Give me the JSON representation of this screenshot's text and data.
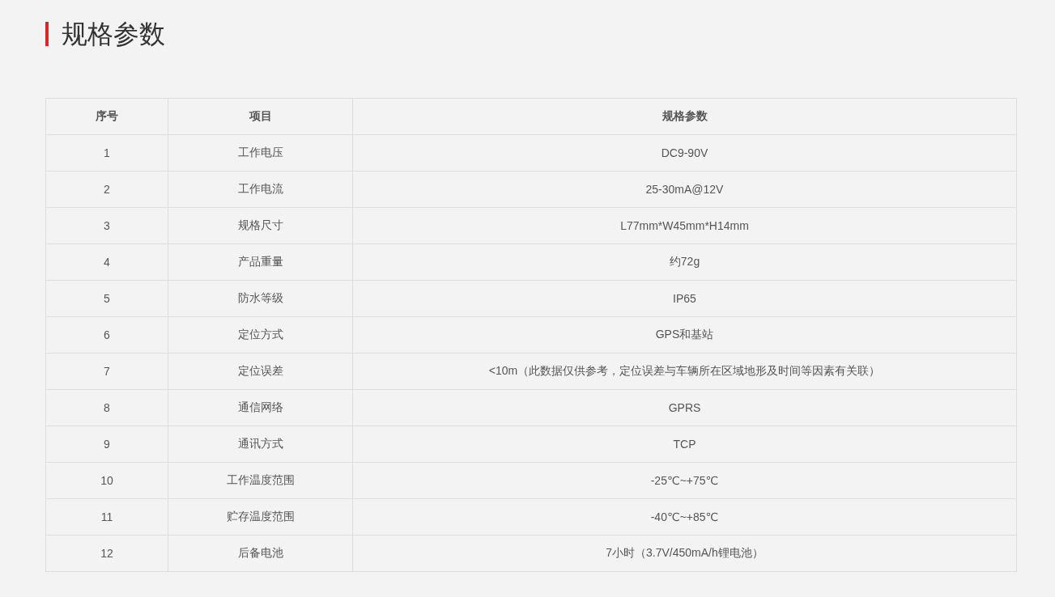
{
  "title": "规格参数",
  "table": {
    "columns": [
      "序号",
      "项目",
      "规格参数"
    ],
    "rows": [
      [
        "1",
        "工作电压",
        "DC9-90V"
      ],
      [
        "2",
        "工作电流",
        "25-30mA@12V"
      ],
      [
        "3",
        "规格尺寸",
        "L77mm*W45mm*H14mm"
      ],
      [
        "4",
        "产品重量",
        "约72g"
      ],
      [
        "5",
        "防水等级",
        "IP65"
      ],
      [
        "6",
        "定位方式",
        "GPS和基站"
      ],
      [
        "7",
        "定位误差",
        "<10m（此数据仅供参考，定位误差与车辆所在区域地形及时间等因素有关联）"
      ],
      [
        "8",
        "通信网络",
        "GPRS"
      ],
      [
        "9",
        "通讯方式",
        "TCP"
      ],
      [
        "10",
        "工作温度范围",
        "-25℃~+75℃"
      ],
      [
        "11",
        "贮存温度范围",
        "-40℃~+85℃"
      ],
      [
        "12",
        "后备电池",
        "7小时（3.7V/450mA/h锂电池）"
      ]
    ]
  }
}
